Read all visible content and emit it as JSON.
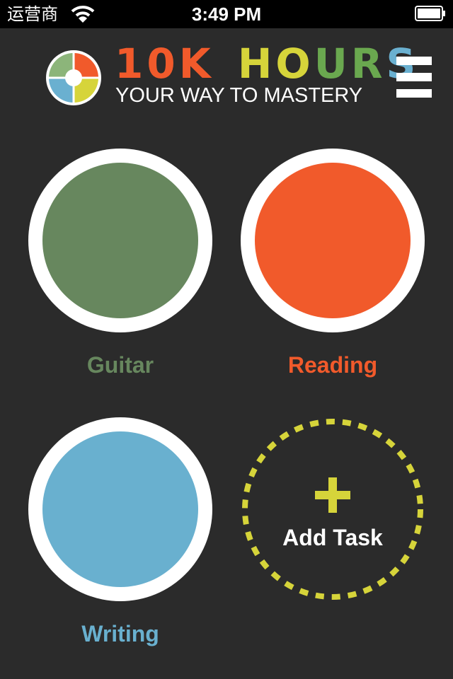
{
  "status_bar": {
    "carrier": "运营商",
    "time": "3:49 PM",
    "wifi_icon": "wifi-icon",
    "battery_icon": "battery-icon"
  },
  "header": {
    "title_parts": [
      {
        "text": "10K",
        "color": "#f15a2b"
      },
      {
        "text": "H",
        "color": "#d6d43a"
      },
      {
        "text": "O",
        "color": "#d6d43a"
      },
      {
        "text": "U",
        "color": "#6aa84f"
      },
      {
        "text": "R",
        "color": "#6aa84f"
      },
      {
        "text": "S",
        "color": "#6ab0d0"
      }
    ],
    "tagline": "YOUR WAY TO MASTERY",
    "logo_icon": "color-wheel-logo-icon",
    "menu_icon": "hamburger-menu-icon",
    "logo_colors": [
      "#f15a2b",
      "#d6d43a",
      "#6ab0d0",
      "#8cb57a"
    ]
  },
  "tasks": [
    {
      "name": "Guitar",
      "color": "#67875e"
    },
    {
      "name": "Reading",
      "color": "#f15a2b"
    },
    {
      "name": "Writing",
      "color": "#69b0cf"
    }
  ],
  "add_task": {
    "label": "Add Task",
    "icon": "plus-icon",
    "color": "#d6d43a"
  },
  "colors": {
    "background": "#2b2b2b",
    "status_bar": "#000000",
    "ring": "#ffffff"
  }
}
